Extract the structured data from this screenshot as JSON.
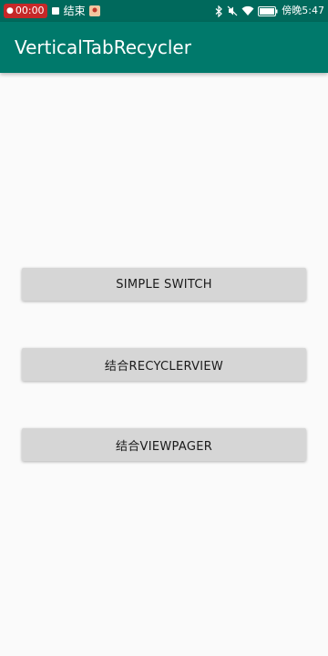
{
  "status_bar": {
    "rec_time": "00:00",
    "rec_action": "结束",
    "network_speed": "",
    "carrier_time": "傍晚5:47",
    "icons": [
      "record-icon",
      "stop-icon",
      "app-icon",
      "bluetooth-icon",
      "mute-icon",
      "wifi-icon",
      "battery-icon"
    ]
  },
  "app_bar": {
    "title": "VerticalTabRecycler"
  },
  "buttons": [
    {
      "label": "SIMPLE SWITCH"
    },
    {
      "label": "结合RECYCLERVIEW"
    },
    {
      "label": "结合VIEWPAGER"
    }
  ],
  "colors": {
    "status_bar": "#00695c",
    "app_bar": "#00796b",
    "background": "#fafafa",
    "button": "#d6d6d6"
  }
}
